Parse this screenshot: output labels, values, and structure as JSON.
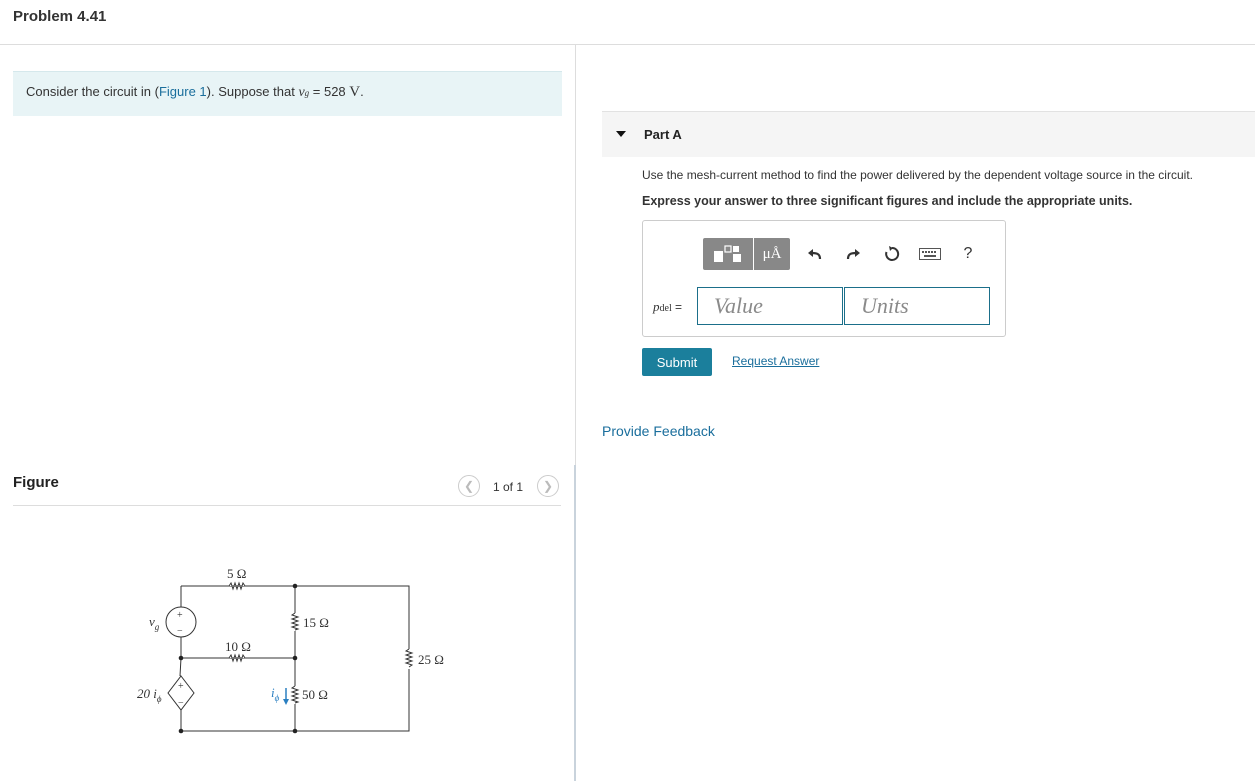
{
  "problem": {
    "title": "Problem 4.41"
  },
  "intro": {
    "prefix": "Consider the circuit in (",
    "figure_link": "Figure 1",
    "middle": "). Suppose that ",
    "var": "v",
    "var_sub": "g",
    "equals": " = 528 ",
    "unit": "V",
    "end": "."
  },
  "figure": {
    "label": "Figure",
    "page": "1 of 1",
    "prev_icon": "chevron-left-icon",
    "next_icon": "chevron-right-icon",
    "circuit": {
      "r1": "5 Ω",
      "r2": "15 Ω",
      "r3": "10 Ω",
      "r4": "25 Ω",
      "r5": "50 Ω",
      "vsrc": "v",
      "vsrc_sub": "g",
      "dep_coef": "20 i",
      "dep_sub": "ϕ",
      "current": "i",
      "current_sub": "ϕ",
      "plus": "+",
      "minus": "−"
    }
  },
  "part_a": {
    "title": "Part A",
    "instruction": "Use the mesh-current method to find the power delivered by the dependent voltage source in the circuit.",
    "express": "Express your answer to three significant figures and include the appropriate units.",
    "toolbar": {
      "templates_icon": "templates-icon",
      "units_label": "μÅ",
      "undo_icon": "undo-icon",
      "redo_icon": "redo-icon",
      "reset_icon": "reset-icon",
      "keyboard_icon": "keyboard-icon",
      "help_label": "?"
    },
    "answer": {
      "label_var": "p",
      "label_sub": "del",
      "label_eq": " =",
      "value_placeholder": "Value",
      "units_placeholder": "Units"
    },
    "submit_label": "Submit",
    "request_label": "Request Answer"
  },
  "feedback_label": "Provide Feedback",
  "colors": {
    "accent": "#1b7f9c",
    "link": "#1a6e9c",
    "intro_bg": "#e8f4f6"
  }
}
